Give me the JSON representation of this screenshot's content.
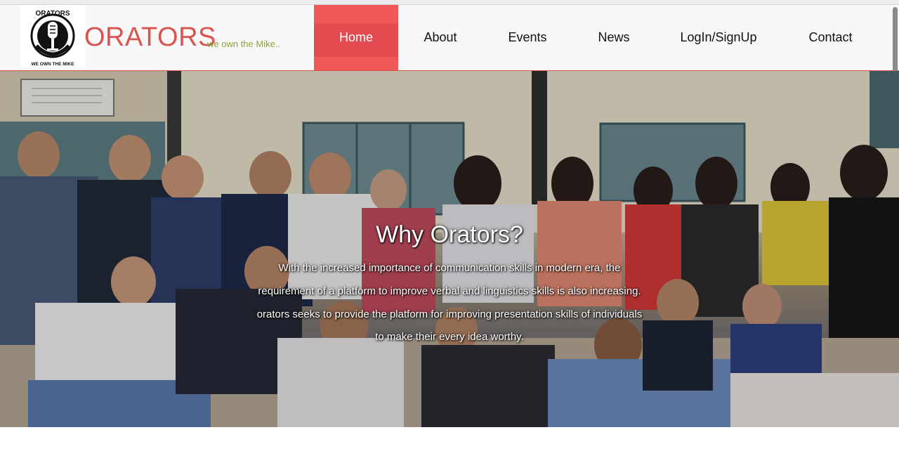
{
  "brand": {
    "name": "ORATORS",
    "tagline": "we own the Mike..",
    "logo_text_top": "ORATORS",
    "logo_text_bottom": "WE OWN THE MIKE"
  },
  "nav": {
    "items": [
      {
        "label": "Home",
        "active": true
      },
      {
        "label": "About"
      },
      {
        "label": "Events"
      },
      {
        "label": "News"
      },
      {
        "label": "LogIn/SignUp"
      },
      {
        "label": "Contact"
      }
    ]
  },
  "hero": {
    "title": "Why Orators?",
    "lines": [
      "With the increased importance of communication skills in modern era, the",
      "requirement of a platform to improve verbal and linguistics skills is also increasing.",
      "orators seeks to provide the platform for improving presentation skills of individuals",
      "to make their every idea worthy."
    ]
  },
  "colors": {
    "brand_red": "#d9534f",
    "nav_active": "#f25757",
    "tagline_green": "#8aa33a"
  }
}
